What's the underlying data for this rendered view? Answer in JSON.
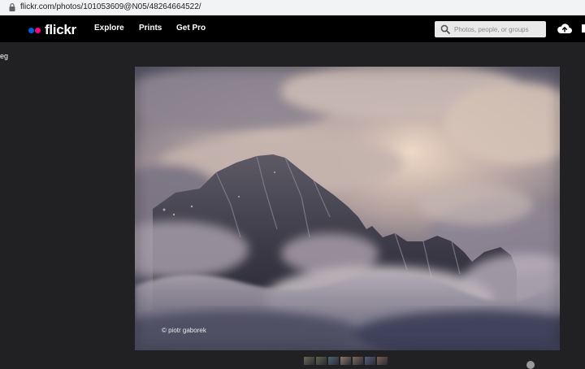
{
  "browser": {
    "url": "flickr.com/photos/101053609@N05/48264664522/"
  },
  "nav": {
    "brand": "flickr",
    "links": [
      "Explore",
      "Prints",
      "Get Pro"
    ],
    "search_placeholder": "Photos, people, or groups"
  },
  "page": {
    "side_text": "eg"
  },
  "photo": {
    "credit": "© piotr gaborek"
  },
  "filmstrip": {
    "thumb_colors": [
      "#6a6650",
      "#58644f",
      "#4f6372",
      "#8b7b6a",
      "#7a6a5a",
      "#535c7a",
      "#7c5d52"
    ]
  },
  "colors": {
    "flickr_blue": "#0063dc",
    "flickr_pink": "#ff0084",
    "background": "#212124",
    "nav_bg": "#000000"
  }
}
